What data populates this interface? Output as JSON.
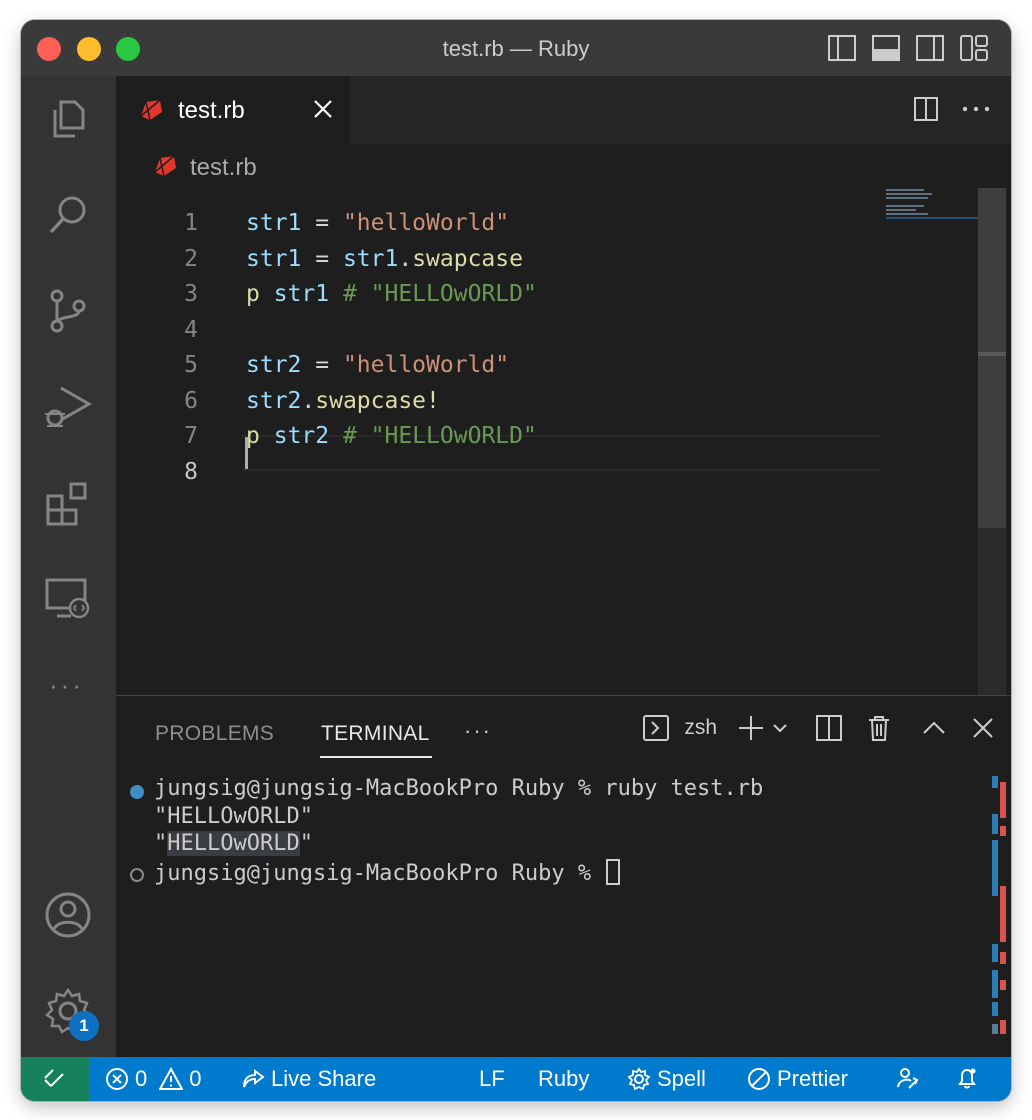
{
  "window": {
    "title": "test.rb — Ruby"
  },
  "tab": {
    "label": "test.rb"
  },
  "breadcrumb": {
    "file": "test.rb"
  },
  "editor": {
    "lines": [
      {
        "num": "1",
        "tokens": [
          [
            "var",
            "str1"
          ],
          [
            "op",
            " = "
          ],
          [
            "str",
            "\"helloWorld\""
          ]
        ]
      },
      {
        "num": "2",
        "tokens": [
          [
            "var",
            "str1"
          ],
          [
            "op",
            " = "
          ],
          [
            "var",
            "str1"
          ],
          [
            "op",
            "."
          ],
          [
            "fn",
            "swapcase"
          ]
        ]
      },
      {
        "num": "3",
        "tokens": [
          [
            "fn",
            "p"
          ],
          [
            "op",
            " "
          ],
          [
            "var",
            "str1"
          ],
          [
            "op",
            " "
          ],
          [
            "cmt",
            "# \"HELLOwORLD\""
          ]
        ]
      },
      {
        "num": "4",
        "tokens": []
      },
      {
        "num": "5",
        "tokens": [
          [
            "var",
            "str2"
          ],
          [
            "op",
            " = "
          ],
          [
            "str",
            "\"helloWorld\""
          ]
        ]
      },
      {
        "num": "6",
        "tokens": [
          [
            "var",
            "str2"
          ],
          [
            "op",
            "."
          ],
          [
            "fn",
            "swapcase!"
          ]
        ]
      },
      {
        "num": "7",
        "tokens": [
          [
            "fn",
            "p"
          ],
          [
            "op",
            " "
          ],
          [
            "var",
            "str2"
          ],
          [
            "op",
            " "
          ],
          [
            "cmt",
            "# \"HELLOwORLD\""
          ]
        ]
      },
      {
        "num": "8",
        "tokens": []
      }
    ],
    "current_line": "8"
  },
  "panel": {
    "tabs": {
      "problems": "PROBLEMS",
      "terminal": "TERMINAL"
    },
    "more": "···",
    "shell": "zsh"
  },
  "terminal": {
    "line1": "jungsig@jungsig-MacBookPro Ruby % ruby test.rb",
    "line2": "\"HELLOwORLD\"",
    "line3_pre": "\"",
    "line3_sel": "HELLOwORLD",
    "line3_post": "\"",
    "line4": "jungsig@jungsig-MacBookPro Ruby % "
  },
  "activity": {
    "more": "···",
    "settings_badge": "1"
  },
  "status": {
    "errors": "0",
    "warnings": "0",
    "live_share": "Live Share",
    "eol": "LF",
    "language": "Ruby",
    "spell": "Spell",
    "prettier": "Prettier"
  },
  "colors": {
    "status_bar": "#007acc",
    "remote": "#16825d",
    "ruby_red": "#e0362c"
  }
}
